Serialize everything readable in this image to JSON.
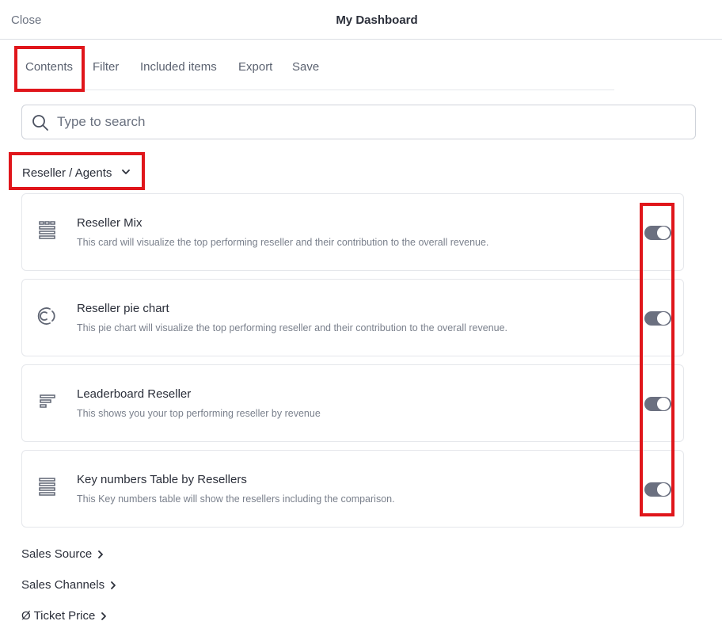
{
  "header": {
    "close_label": "Close",
    "title": "My Dashboard"
  },
  "tabs": [
    {
      "label": "Contents",
      "active": true
    },
    {
      "label": "Filter"
    },
    {
      "label": "Included items"
    },
    {
      "label": "Export"
    },
    {
      "label": "Save"
    }
  ],
  "search": {
    "placeholder": "Type to search",
    "value": ""
  },
  "group": {
    "label": "Reseller / Agents",
    "expanded": true,
    "items": [
      {
        "icon": "table-grid-icon",
        "title": "Reseller Mix",
        "description": "This card will visualize the top performing reseller and their contribution to the overall revenue.",
        "enabled": true
      },
      {
        "icon": "pie-chart-icon",
        "title": "Reseller pie chart",
        "description": "This pie chart will visualize the top performing reseller and their contribution to the overall revenue.",
        "enabled": true
      },
      {
        "icon": "leaderboard-icon",
        "title": "Leaderboard Reseller",
        "description": "This shows you your top performing reseller by revenue",
        "enabled": true
      },
      {
        "icon": "table-rows-icon",
        "title": "Key numbers Table by Resellers",
        "description": "This Key numbers table will show the resellers including the comparison.",
        "enabled": true
      }
    ]
  },
  "sections": [
    {
      "label": "Sales Source"
    },
    {
      "label": "Sales Channels"
    },
    {
      "label": "Ø Ticket Price"
    }
  ],
  "colors": {
    "highlight": "#e0161b",
    "toggle_on": "#6b7080",
    "border": "#e5e7eb"
  }
}
